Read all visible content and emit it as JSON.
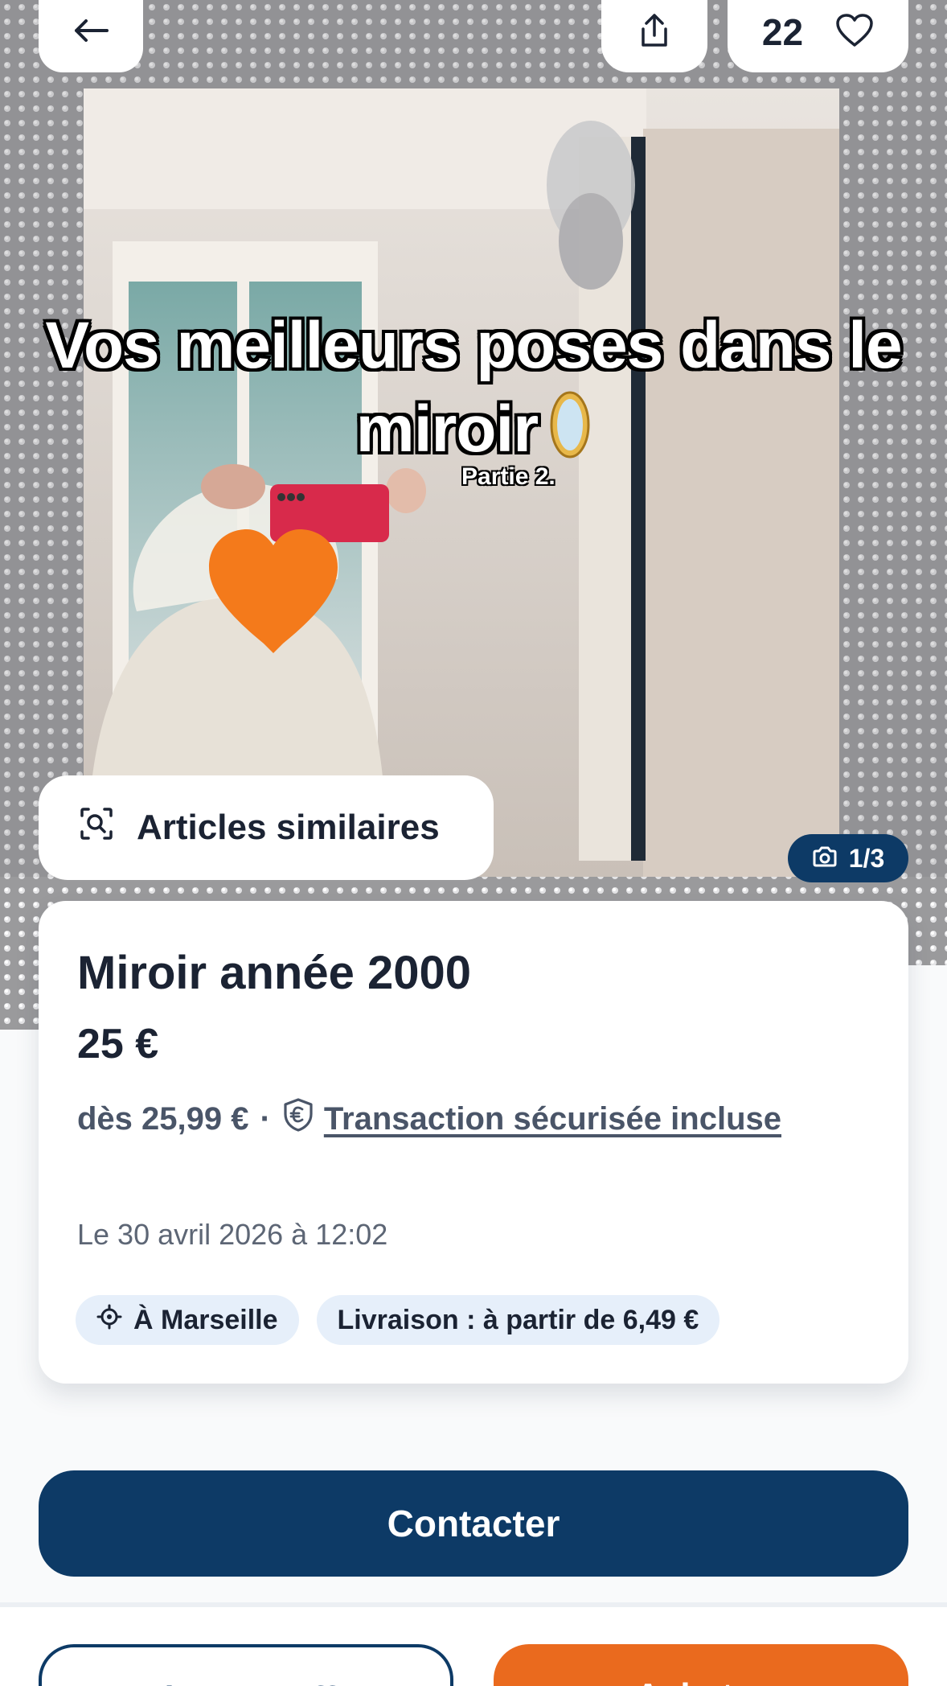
{
  "photo": {
    "overlay_title_line1": "Vos meilleurs poses dans le",
    "overlay_title_line2": "miroir",
    "overlay_subtitle": "Partie 2.",
    "counter": "1/3"
  },
  "header": {
    "favorites_count": "22",
    "icons": [
      "back-arrow-icon",
      "share-icon",
      "heart-icon"
    ]
  },
  "similar_button_label": "Articles similaires",
  "item": {
    "title": "Miroir année 2000",
    "price": "25 €",
    "buyer_price": "dès 25,99 €",
    "separator": "·",
    "protection_link": "Transaction sécurisée incluse",
    "date": "Le 30 avril 2026 à 12:02",
    "location": "À Marseille",
    "shipping": "Livraison : à partir de 6,49 €"
  },
  "actions": {
    "contact": "Contacter",
    "make_offer": "Faire une offre",
    "buy": "Acheter"
  },
  "colors": {
    "primary": "#0d3a66",
    "accent": "#ea6a1e",
    "chip_bg": "#e6effa"
  }
}
